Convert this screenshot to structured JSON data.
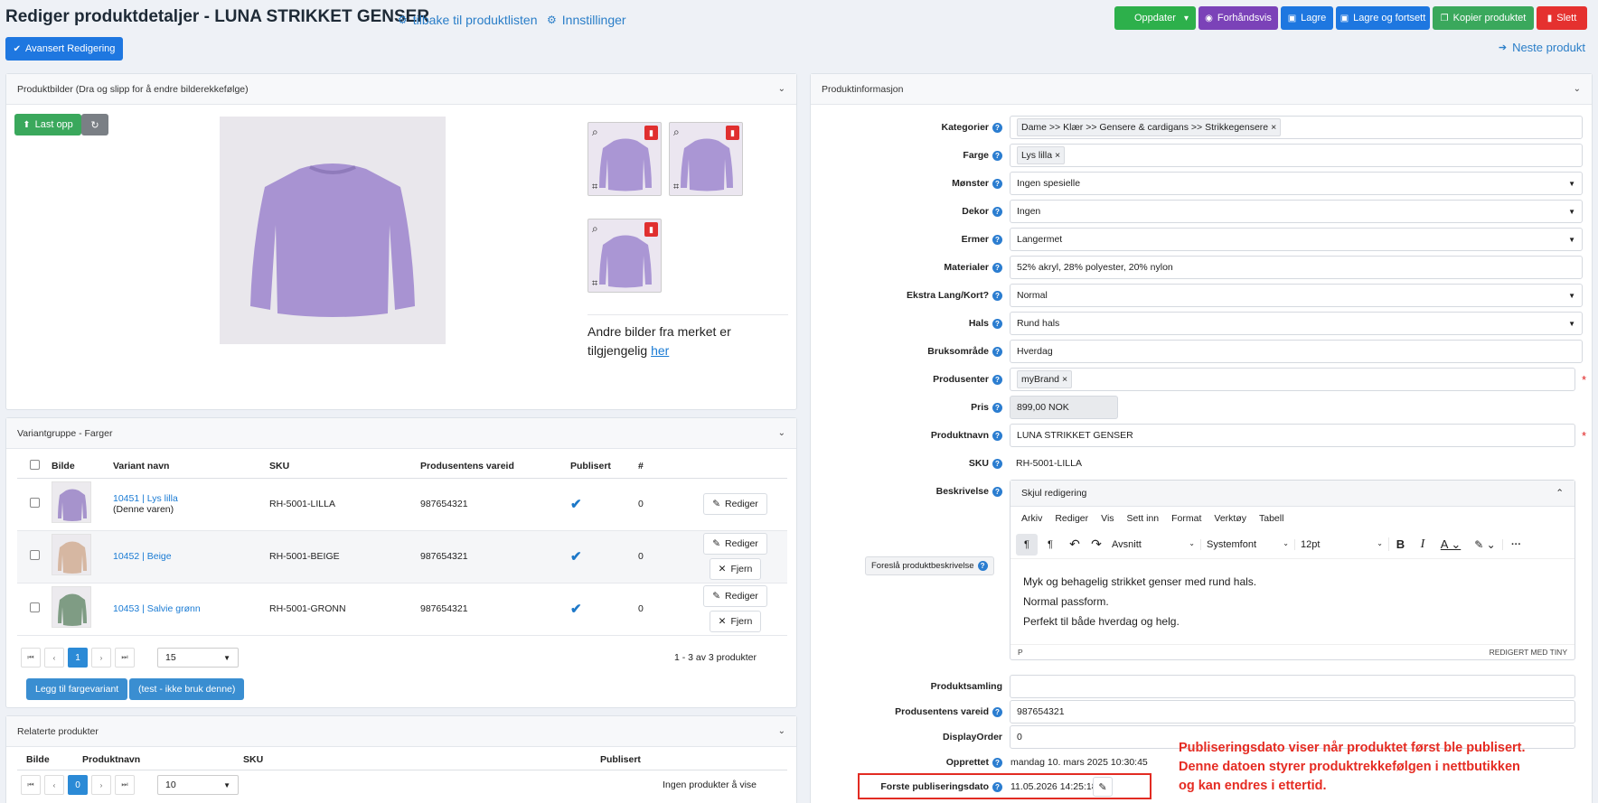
{
  "header": {
    "title": "Rediger produktdetaljer - LUNA STRIKKET GENSER",
    "back_link": "tilbake til produktlisten",
    "settings_link": "Innstillinger",
    "advanced_btn": "Avansert Redigering",
    "next_product": "Neste produkt"
  },
  "toolbar": {
    "update": "Oppdater",
    "preview": "Forhåndsvis",
    "save": "Lagre",
    "save_continue": "Lagre og fortsett",
    "copy": "Kopier produktet",
    "delete": "Slett"
  },
  "images": {
    "title": "Produktbilder (Dra og slipp for å endre bilderekkefølge)",
    "upload": "Last opp",
    "other_text": "Andre bilder fra merket er tilgjengelig",
    "other_link": "her"
  },
  "variants": {
    "title": "Variantgruppe - Farger",
    "columns": [
      "Bilde",
      "Variant navn",
      "SKU",
      "Produsentens vareid",
      "Publisert",
      "#"
    ],
    "rows": [
      {
        "name": "10451 | Lys lilla",
        "sub": "(Denne varen)",
        "sku": "RH-5001-LILLA",
        "vendor_id": "987654321",
        "count": "0",
        "color": "#a693cc",
        "edit": "Rediger",
        "remove": ""
      },
      {
        "name": "10452 | Beige",
        "sub": "",
        "sku": "RH-5001-BEIGE",
        "vendor_id": "987654321",
        "count": "0",
        "color": "#d6b7a2",
        "edit": "Rediger",
        "remove": "Fjern"
      },
      {
        "name": "10453 | Salvie grønn",
        "sub": "",
        "sku": "RH-5001-GRONN",
        "vendor_id": "987654321",
        "count": "0",
        "color": "#7f9c84",
        "edit": "Rediger",
        "remove": "Fjern"
      }
    ],
    "page": "1",
    "page_size": "15",
    "summary": "1 - 3 av 3 produkter",
    "add_color": "Legg til fargevariant",
    "test_btn": "(test - ikke bruk denne)"
  },
  "related": {
    "title": "Relaterte produkter",
    "columns": [
      "Bilde",
      "Produktnavn",
      "SKU",
      "Publisert"
    ],
    "page": "0",
    "page_size": "10",
    "empty": "Ingen produkter å vise"
  },
  "info": {
    "title": "Produktinformasjon",
    "kategorier_label": "Kategorier",
    "kategorier_tag": "Dame >> Klær >> Gensere & cardigans >> Strikkegensere",
    "farge_label": "Farge",
    "farge_tag": "Lys lilla",
    "monster_label": "Mønster",
    "monster_value": "Ingen spesielle",
    "dekor_label": "Dekor",
    "dekor_value": "Ingen",
    "ermer_label": "Ermer",
    "ermer_value": "Langermet",
    "materialer_label": "Materialer",
    "materialer_value": "52% akryl, 28% polyester, 20% nylon",
    "ekstra_label": "Ekstra Lang/Kort?",
    "ekstra_value": "Normal",
    "hals_label": "Hals",
    "hals_value": "Rund hals",
    "bruk_label": "Bruksområde",
    "bruk_value": "Hverdag",
    "produsenter_label": "Produsenter",
    "produsenter_tag": "myBrand",
    "pris_label": "Pris",
    "pris_value": "899,00 NOK",
    "produktnavn_label": "Produktnavn",
    "produktnavn_value": "LUNA STRIKKET GENSER",
    "sku_label": "SKU",
    "sku_value": "RH-5001-LILLA",
    "beskrivelse_label": "Beskrivelse",
    "hide_edit": "Skjul redigering",
    "suggest_btn": "Foreslå produktbeskrivelse",
    "menu": [
      "Arkiv",
      "Rediger",
      "Vis",
      "Sett inn",
      "Format",
      "Verktøy",
      "Tabell"
    ],
    "block_format": "Avsnitt",
    "font": "Systemfont",
    "size": "12pt",
    "desc_lines": [
      "Myk og behagelig strikket genser med rund hals.",
      "Normal passform.",
      "Perfekt til både hverdag og helg."
    ],
    "status_tag": "P",
    "tiny": "REDIGERT MED TINY",
    "samling_label": "Produktsamling",
    "samling_value": "",
    "vareid_label": "Produsentens vareid",
    "vareid_value": "987654321",
    "order_label": "DisplayOrder",
    "order_value": "0",
    "opprettet_label": "Opprettet",
    "opprettet_value": "mandag 10. mars 2025 10:30:45",
    "publ_label": "Forste publiseringsdato",
    "publ_value": "11.05.2026 14:25:18"
  },
  "annotation": {
    "lines": [
      "Publiseringsdato viser når produktet først ble publisert.",
      "Denne datoen styrer produktrekkefølgen i nettbutikken",
      "og kan endres i ettertid."
    ],
    "color": "#e52b22"
  }
}
